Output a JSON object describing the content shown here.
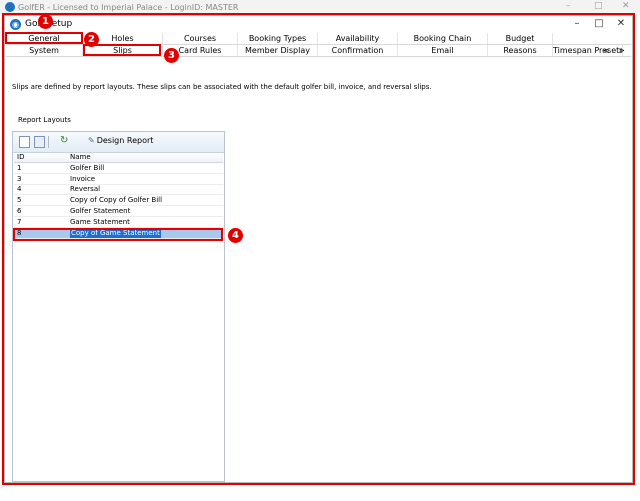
{
  "background_app": {
    "title": "GolfER - Licensed to Imperial Palace - LoginID: MASTER"
  },
  "dialog": {
    "title": "Golf Setup",
    "minimize_glyph": "–",
    "maximize_glyph": "□",
    "close_glyph": "✕"
  },
  "tabs_top": [
    "General",
    "Holes",
    "Courses",
    "Booking Types",
    "Availability",
    "Booking Chain",
    "Budget"
  ],
  "tabs_second": [
    "System",
    "Slips",
    "Card Rules",
    "Member Display",
    "Confirmation",
    "Email",
    "Reasons",
    "Timespan Presets"
  ],
  "scroll_arrows": "< >",
  "description": "Slips are defined by report layouts. These slips can be associated with the default golfer bill, invoice, and reversal slips.",
  "report_layouts": {
    "label": "Report Layouts",
    "design_report_label": "Design Report",
    "columns": [
      "ID",
      "Name"
    ],
    "rows": [
      {
        "id": "1",
        "name": "Golfer Bill"
      },
      {
        "id": "3",
        "name": "Invoice"
      },
      {
        "id": "4",
        "name": "Reversal"
      },
      {
        "id": "5",
        "name": "Copy of Copy of Golfer Bill"
      },
      {
        "id": "6",
        "name": "Golfer Statement"
      },
      {
        "id": "7",
        "name": "Game Statement"
      },
      {
        "id": "8",
        "name": "Copy of Game Statement"
      }
    ],
    "selected_row_id": "8"
  },
  "annotations": [
    "1",
    "2",
    "3",
    "4"
  ],
  "colors": {
    "highlight_red": "#e00000",
    "selection_blue": "#1f6fd1",
    "title_icon_blue": "#1e73be"
  }
}
